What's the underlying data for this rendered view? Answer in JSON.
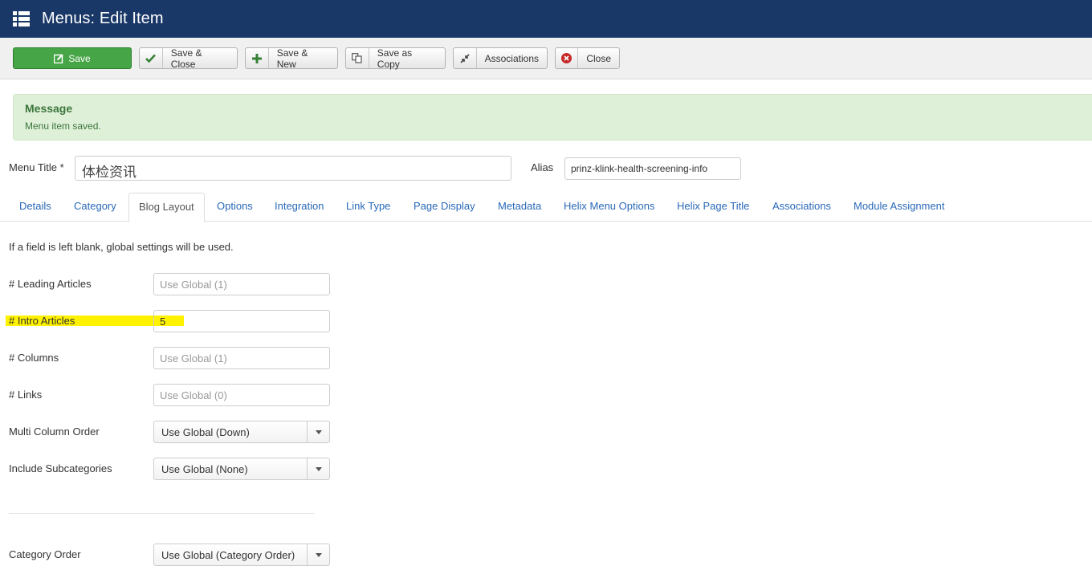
{
  "header": {
    "title": "Menus: Edit Item",
    "icon": "list-icon"
  },
  "toolbar": {
    "save": "Save",
    "save_close": "Save & Close",
    "save_new": "Save & New",
    "save_copy": "Save as Copy",
    "associations": "Associations",
    "close": "Close"
  },
  "message": {
    "heading": "Message",
    "text": "Menu item saved."
  },
  "title_row": {
    "menu_title_label": "Menu Title",
    "required_mark": "*",
    "menu_title_value": "体检资讯",
    "alias_label": "Alias",
    "alias_value": "prinz-klink-health-screening-info"
  },
  "tabs": [
    "Details",
    "Category",
    "Blog Layout",
    "Options",
    "Integration",
    "Link Type",
    "Page Display",
    "Metadata",
    "Helix Menu Options",
    "Helix Page Title",
    "Associations",
    "Module Assignment"
  ],
  "active_tab": "Blog Layout",
  "form": {
    "hint": "If a field is left blank, global settings will be used.",
    "leading_articles": {
      "label": "# Leading Articles",
      "placeholder": "Use Global (1)"
    },
    "intro_articles": {
      "label": "# Intro Articles",
      "value": "5"
    },
    "columns": {
      "label": "# Columns",
      "placeholder": "Use Global (1)"
    },
    "links": {
      "label": "# Links",
      "placeholder": "Use Global (0)"
    },
    "multi_column_order": {
      "label": "Multi Column Order",
      "value": "Use Global (Down)"
    },
    "include_subcategories": {
      "label": "Include Subcategories",
      "value": "Use Global (None)"
    },
    "category_order": {
      "label": "Category Order",
      "value": "Use Global (Category Order)"
    }
  },
  "colors": {
    "header_bg": "#1a3867",
    "save_green": "#46a546",
    "message_bg": "#dff0d8",
    "message_text": "#3c763d",
    "link_blue": "#2a69b8",
    "highlight_yellow": "#fff200"
  }
}
